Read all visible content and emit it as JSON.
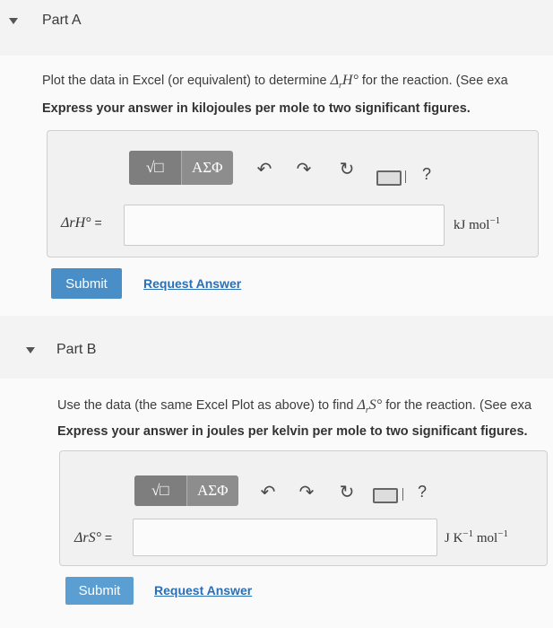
{
  "partA": {
    "title": "Part A",
    "instruction_prefix": "Plot the data in Excel (or equivalent) to determine ",
    "instruction_suffix": " for the reaction. (See exa",
    "emphasis": "Express your answer in kilojoules per mole to two significant figures.",
    "quantity": "ΔrH°",
    "label_eq": " =",
    "input_value": "",
    "unit_main": "kJ mol",
    "unit_exp": "−1",
    "submit_label": "Submit",
    "request_label": "Request Answer"
  },
  "partB": {
    "title": "Part B",
    "instruction_prefix": "Use the data (the same Excel Plot as above) to find ",
    "instruction_suffix": " for the reaction. (See exa",
    "emphasis": "Express your answer in joules per kelvin per mole to two significant figures.",
    "quantity": "ΔrS°",
    "label_eq": " =",
    "input_value": "",
    "unit_main1": "J K",
    "unit_exp1": "−1",
    "unit_main2": " mol",
    "unit_exp2": "−1",
    "submit_label": "Submit",
    "request_label": "Request Answer"
  },
  "toolbar": {
    "templates_label": "√□",
    "symbols_label": "ΑΣΦ",
    "help_label": "?",
    "icons": [
      "templates-icon",
      "greek-symbols-icon",
      "undo-icon",
      "redo-icon",
      "reset-icon",
      "keyboard-icon",
      "help-icon"
    ]
  },
  "colors": {
    "submit": "#4a8ec7",
    "link": "#2a6fb5",
    "toolbar": "#8d8d8d"
  }
}
